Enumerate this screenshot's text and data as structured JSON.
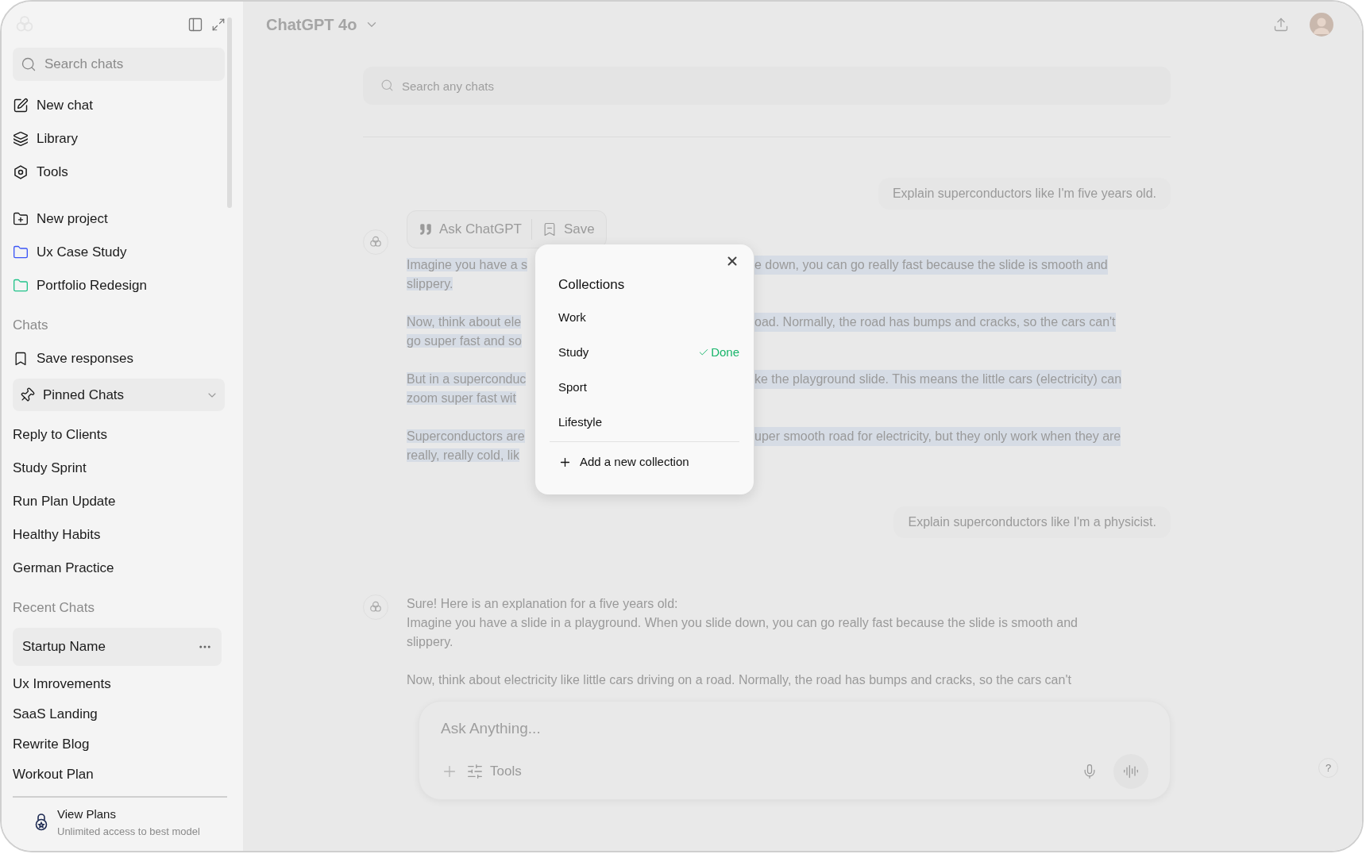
{
  "sidebar": {
    "search": {
      "placeholder": "Search chats"
    },
    "nav": [
      {
        "kind": "new-chat",
        "label": "New chat"
      },
      {
        "kind": "library",
        "label": "Library"
      },
      {
        "kind": "tools",
        "label": "Tools"
      }
    ],
    "new_project": "New project",
    "projects": [
      {
        "label": "Ux Case Study",
        "color": "#3b55f6"
      },
      {
        "label": "Portfolio Redesign",
        "color": "#22c38a"
      }
    ],
    "chats_heading": "Chats",
    "save_responses": "Save responses",
    "pinned_label": "Pinned Chats",
    "pinned_chats": [
      "Reply to Clients",
      "Study Sprint",
      "Run Plan Update",
      "Healthy Habits",
      "German Practice"
    ],
    "recent_heading": "Recent Chats",
    "recent_chats": [
      {
        "label": "Startup Name",
        "selected": true
      },
      {
        "label": "Ux Imrovements",
        "selected": false
      },
      {
        "label": "SaaS Landing",
        "selected": false
      },
      {
        "label": "Rewrite Blog",
        "selected": false
      },
      {
        "label": "Workout Plan",
        "selected": false
      }
    ],
    "plan": {
      "title": "View Plans",
      "subtitle": "Unlimited access to best model"
    }
  },
  "header": {
    "model": "ChatGPT 4o"
  },
  "chat_search": {
    "placeholder": "Search any chats"
  },
  "messages": [
    {
      "kind": "user",
      "text": "Explain superconductors like I'm five years old."
    },
    {
      "kind": "assistant",
      "highlighted": true,
      "paragraphs": [
        {
          "lines": [
            {
              "left": "Imagine you have a s",
              "right": "e down, you can go really fast because the slide is smooth and"
            },
            {
              "left": "slippery."
            }
          ]
        },
        {
          "lines": [
            {
              "left": "Now, think about ele",
              "right": "oad. Normally, the road has bumps and cracks, so the cars can't"
            },
            {
              "left": "go super fast and so"
            }
          ]
        },
        {
          "lines": [
            {
              "left": "But in a superconduc",
              "right": "ke the playground slide. This means the little cars (electricity) can"
            },
            {
              "left": "zoom super fast wit"
            }
          ]
        },
        {
          "lines": [
            {
              "left": "Superconductors are",
              "right": "uper smooth road for electricity, but they only work when they are"
            },
            {
              "left": "really, really cold, lik"
            }
          ]
        }
      ]
    },
    {
      "kind": "user",
      "text": "Explain superconductors like I'm a physicist."
    },
    {
      "kind": "assistant",
      "highlighted": false,
      "paragraphs": [
        {
          "lines": [
            {
              "left": "Sure! Here is an explanation for a five years old:"
            },
            {
              "left": "Imagine you have a slide in a playground. When you slide down, you can go really fast because the slide is smooth and"
            },
            {
              "left": "slippery."
            }
          ]
        },
        {
          "lines": [
            {
              "left": "Now, think about electricity like little cars driving on a road. Normally, the road has bumps and cracks, so the cars can't"
            }
          ]
        }
      ]
    }
  ],
  "selection_toolbar": {
    "ask": "Ask ChatGPT",
    "save": "Save"
  },
  "collections_popup": {
    "title": "Collections",
    "done_label": "Done",
    "items": [
      {
        "label": "Work",
        "selected": false
      },
      {
        "label": "Study",
        "selected": true
      },
      {
        "label": "Sport",
        "selected": false
      },
      {
        "label": "Lifestyle",
        "selected": false
      }
    ],
    "add": "Add a new collection"
  },
  "composer": {
    "placeholder": "Ask Anything...",
    "tools": "Tools"
  },
  "help": "?"
}
